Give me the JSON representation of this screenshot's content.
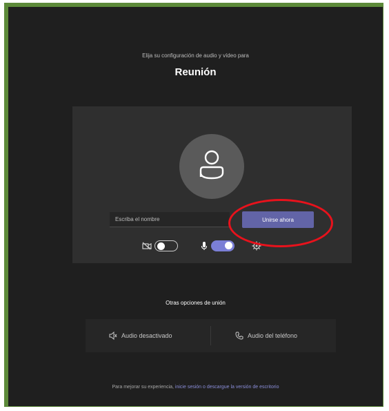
{
  "prejoin": {
    "subtitle": "Elija su configuración de audio y vídeo para",
    "meeting_title": "Reunión"
  },
  "card": {
    "name_placeholder": "Escriba el nombre",
    "join_button_label": "Unirse ahora",
    "controls": {
      "camera": {
        "icon": "camera-off-icon",
        "state": "off"
      },
      "microphone": {
        "icon": "microphone-icon",
        "state": "on"
      },
      "device_settings": {
        "icon": "gear-icon",
        "label": "· · · ·"
      }
    }
  },
  "other_options": {
    "title": "Otras opciones de unión",
    "audio_off_label": "Audio desactivado",
    "phone_audio_label": "Audio del teléfono"
  },
  "footer": {
    "prefix": "Para mejorar su experiencia, ",
    "link_text": "inicie sesión o descargue la versión de escritorio"
  },
  "colors": {
    "background": "#1f1f1f",
    "card": "#2f2f2f",
    "accent": "#6264a7",
    "toggle_on": "#7b7fd6",
    "annotation": "#e8121c",
    "frame": "#5d8a3a"
  }
}
